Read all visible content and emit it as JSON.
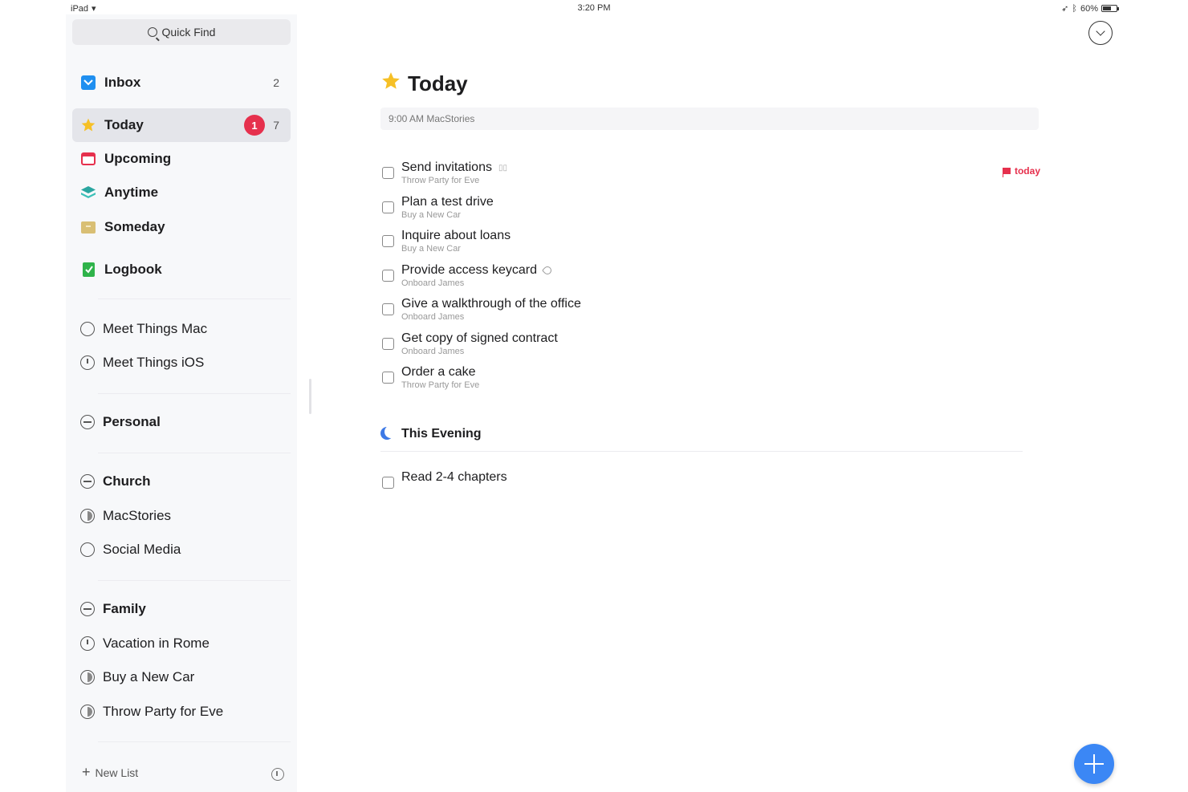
{
  "status_bar": {
    "device": "iPad",
    "time": "3:20 PM",
    "battery": "60%"
  },
  "sidebar": {
    "quick_find": "Quick Find",
    "smart_lists": [
      {
        "label": "Inbox",
        "count": "2"
      },
      {
        "label": "Today",
        "badge": "1",
        "count": "7"
      },
      {
        "label": "Upcoming"
      },
      {
        "label": "Anytime"
      },
      {
        "label": "Someday"
      },
      {
        "label": "Logbook"
      }
    ],
    "projects": [
      "Meet Things Mac",
      "Meet Things iOS"
    ],
    "area_personal": "Personal",
    "area_church": "Church",
    "church_projects": [
      "MacStories",
      "Social Media"
    ],
    "area_family": "Family",
    "family_projects": [
      "Vacation in Rome",
      "Buy a New Car",
      "Throw Party for Eve"
    ],
    "new_list": "New List"
  },
  "main": {
    "title": "Today",
    "event": "9:00 AM MacStories",
    "tasks": [
      {
        "title": "Send invitations",
        "project": "Throw Party for Eve",
        "deadline": "today"
      },
      {
        "title": "Plan a test drive",
        "project": "Buy a New Car"
      },
      {
        "title": "Inquire about loans",
        "project": "Buy a New Car"
      },
      {
        "title": "Provide access keycard",
        "project": "Onboard James"
      },
      {
        "title": "Give a walkthrough of the office",
        "project": "Onboard James"
      },
      {
        "title": "Get copy of signed contract",
        "project": "Onboard James"
      },
      {
        "title": "Order a cake",
        "project": "Throw Party for Eve"
      }
    ],
    "evening_heading": "This Evening",
    "evening_tasks": [
      {
        "title": "Read 2-4 chapters"
      }
    ]
  },
  "colors": {
    "badge": "#e6304d",
    "accent": "#3b87f5",
    "today_star": "#f6c026"
  }
}
